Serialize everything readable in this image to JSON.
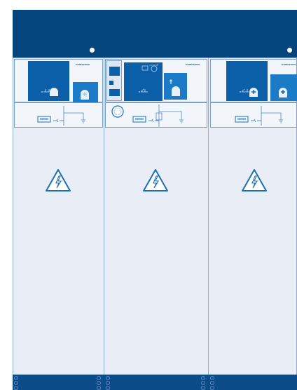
{
  "panels": [
    {
      "id": "left",
      "brand": "HAWAZANA"
    },
    {
      "id": "middle",
      "brand": "HAWAZANA"
    },
    {
      "id": "right",
      "brand": "HAWAZANA"
    }
  ],
  "icons": {
    "warning": "high-voltage-warning-icon",
    "indicator": "indicator-dot-icon",
    "earthing": "earth-symbol-icon",
    "meter": "circular-meter-icon"
  },
  "colors": {
    "top_band": "#04457e",
    "panel_bg": "#e9eef6",
    "mimic_dark": "#0b5ea8",
    "mimic_light": "#1b7bc6",
    "plinth": "#0c4c88",
    "line": "#7f9fcb"
  }
}
